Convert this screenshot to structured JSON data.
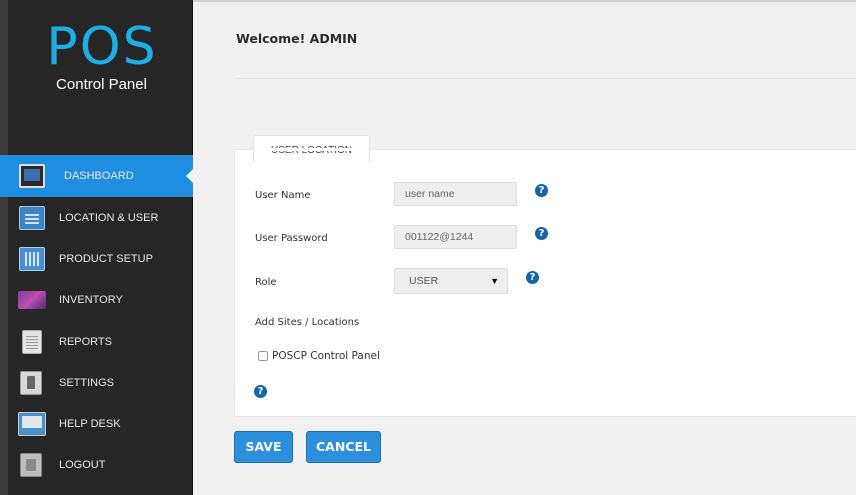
{
  "logo": {
    "text": "POS",
    "subtitle": "Control Panel"
  },
  "sidebar": {
    "items": [
      {
        "label": "DASHBOARD",
        "icon": "monitor-icon",
        "active": true
      },
      {
        "label": "LOCATION & USER",
        "icon": "building-icon"
      },
      {
        "label": "PRODUCT SETUP",
        "icon": "product-icon"
      },
      {
        "label": "INVENTORY",
        "icon": "inventory-icon"
      },
      {
        "label": "REPORTS",
        "icon": "reports-icon"
      },
      {
        "label": "SETTINGS",
        "icon": "settings-icon"
      },
      {
        "label": "HELP DESK",
        "icon": "help-desk-icon"
      },
      {
        "label": "LOGOUT",
        "icon": "logout-icon"
      }
    ]
  },
  "header": {
    "welcome": "Welcome! ADMIN"
  },
  "form": {
    "tab_label": "USER LOCATION",
    "user_name_label": "User Name",
    "user_name_placeholder": "user name",
    "user_password_label": "User Password",
    "user_password_value": "001122@1244",
    "role_label": "Role",
    "role_value": "USER",
    "add_sites_label": "Add Sites  /  Locations",
    "checkbox_label": "POSCP Control Panel",
    "help_glyph": "?",
    "select_arrow": "▼"
  },
  "buttons": {
    "save": "SAVE",
    "cancel": "CANCEL"
  },
  "colors": {
    "accent": "#2c8fdb",
    "sidebar_bg": "#262626",
    "logo": "#1eaee6",
    "help": "#1763a8"
  }
}
